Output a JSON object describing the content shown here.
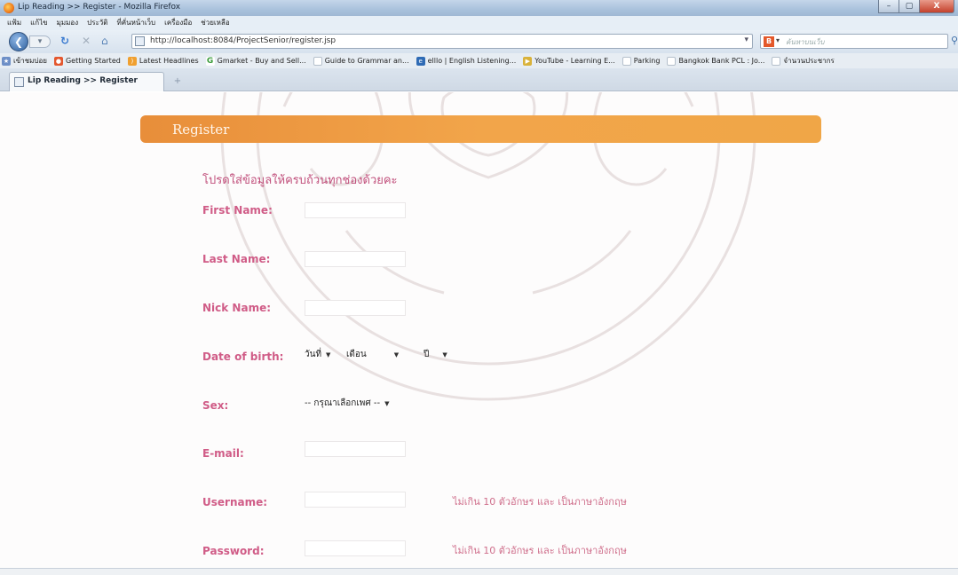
{
  "window": {
    "title": "Lip Reading >> Register - Mozilla Firefox",
    "buttons": [
      "–",
      "▢",
      "X"
    ]
  },
  "menu": [
    "แฟ้ม",
    "แก้ไข",
    "มุมมอง",
    "ประวัติ",
    "ที่คั่นหน้าเว็บ",
    "เครื่องมือ",
    "ช่วยเหลือ"
  ],
  "nav": {
    "url": "http://localhost:8084/ProjectSenior/register.jsp",
    "search_placeholder": "ค้นหาบนเว็บ"
  },
  "bookmarks": [
    {
      "label": "เข้าชมบ่อย",
      "icon": "star-icon",
      "color": "#6d8fc7"
    },
    {
      "label": "Getting Started",
      "icon": "firefox-icon",
      "color": "#e4572e"
    },
    {
      "label": "Latest Headlines",
      "icon": "rss-icon",
      "color": "#f0a030"
    },
    {
      "label": "Gmarket - Buy and Sell...",
      "icon": "gmarket-icon",
      "color": "#3a9b3a"
    },
    {
      "label": "Guide to Grammar an...",
      "icon": "page-icon",
      "color": "#c9d3de"
    },
    {
      "label": "elllo | English Listening...",
      "icon": "elllo-icon",
      "color": "#2f6bb5"
    },
    {
      "label": "YouTube - Learning E...",
      "icon": "youtube-icon",
      "color": "#d9b23a"
    },
    {
      "label": "Parking",
      "icon": "page-icon",
      "color": "#c9d3de"
    },
    {
      "label": "Bangkok Bank PCL : Jo...",
      "icon": "page-icon",
      "color": "#c9d3de"
    },
    {
      "label": "จำนวนประชากร",
      "icon": "page-icon",
      "color": "#c9d3de"
    }
  ],
  "tab": {
    "title": "Lip Reading >> Register"
  },
  "form": {
    "header": "Register",
    "instruction": "โปรดใส่ข้อมูลให้ครบถ้วนทุกช่องด้วยคะ",
    "labels": {
      "first_name": "First Name:",
      "last_name": "Last Name:",
      "nick_name": "Nick Name:",
      "dob": "Date of birth:",
      "sex": "Sex:",
      "email": "E-mail:",
      "username": "Username:",
      "password": "Password:"
    },
    "dob_selects": {
      "day": "วันที่",
      "month": "เดือน",
      "year": "ปี"
    },
    "sex_select": "-- กรุณาเลือกเพศ --",
    "hints": {
      "username": "ไม่เกิน 10 ตัวอักษร และ เป็นภาษาอังกฤษ",
      "password": "ไม่เกิน 10 ตัวอักษร และ เป็นภาษาอังกฤษ"
    }
  },
  "colors": {
    "header_orange": "#f0a047",
    "label_pink": "#d05c87"
  }
}
